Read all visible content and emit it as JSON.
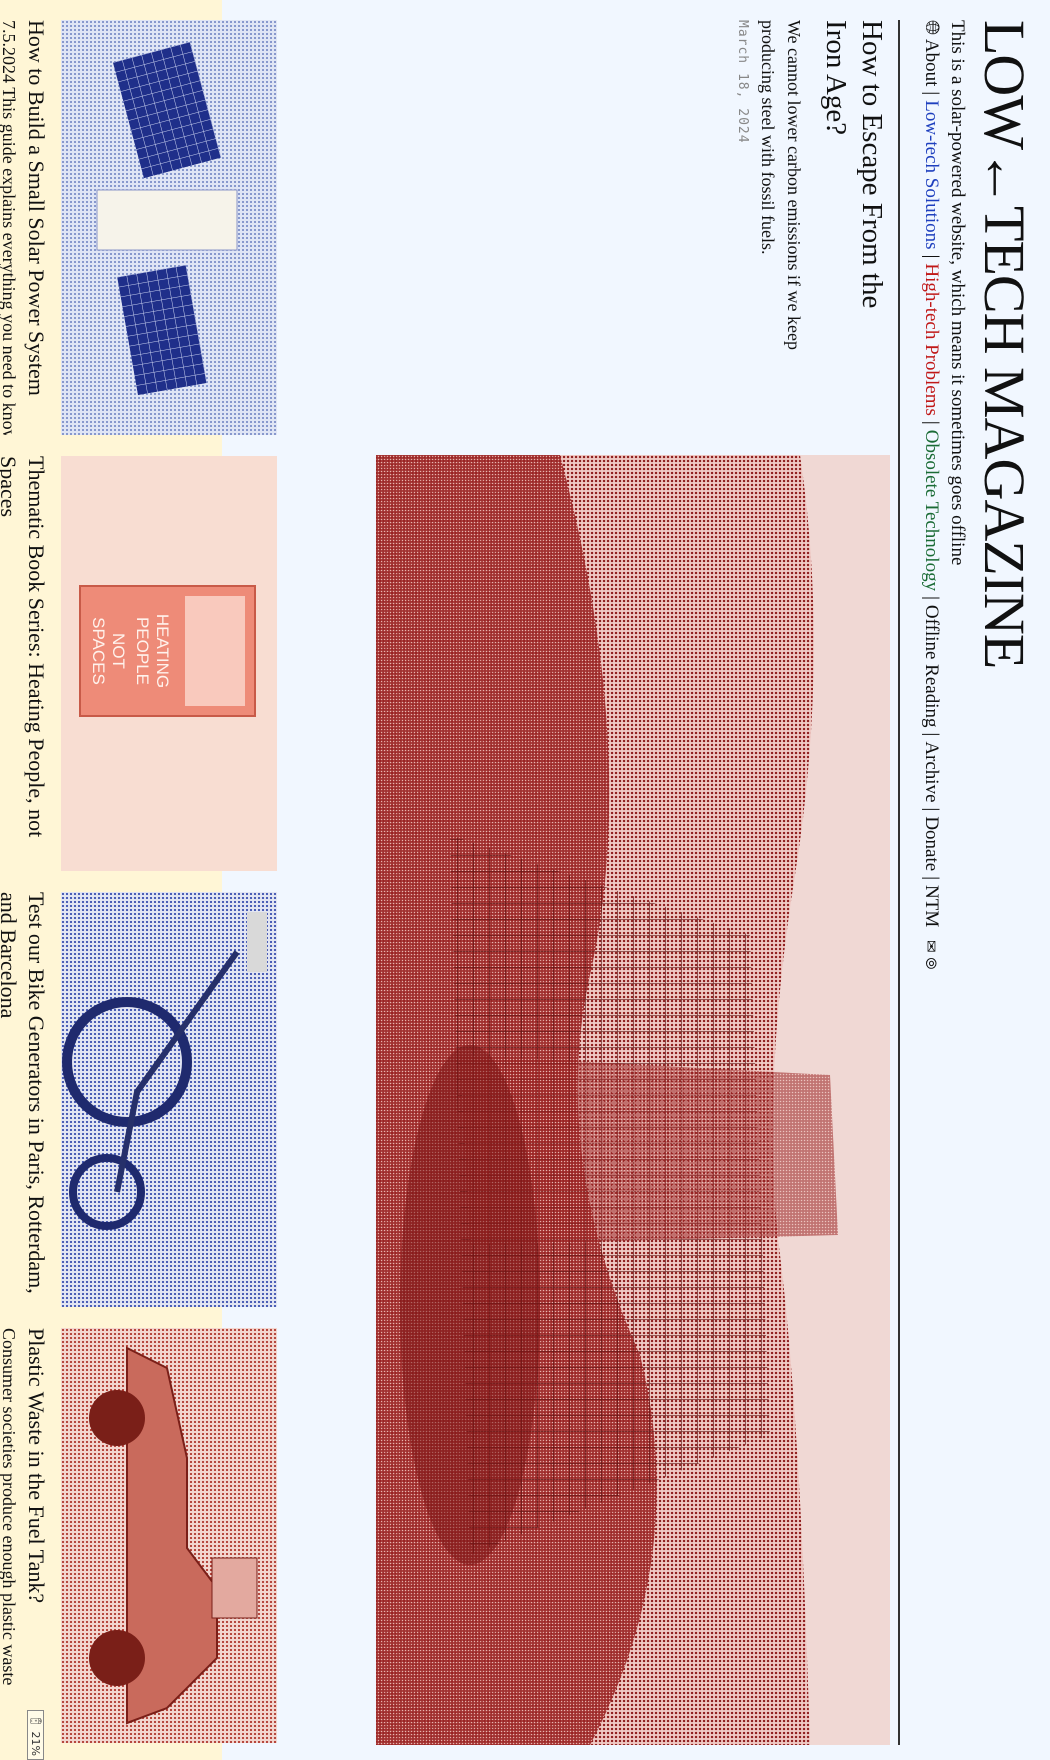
{
  "site": {
    "title": "LOW←TECH MAGAZINE",
    "tagline": "This is a solar-powered website, which means it sometimes goes offline",
    "nav": [
      {
        "label": "About",
        "color": "#111111"
      },
      {
        "label": "Low-tech Solutions",
        "color": "#1e3fbe"
      },
      {
        "label": "High-tech Problems",
        "color": "#c01818"
      },
      {
        "label": "Obsolete Technology",
        "color": "#1a6b35"
      },
      {
        "label": "Offline Reading",
        "color": "#111111"
      },
      {
        "label": "Archive",
        "color": "#111111"
      },
      {
        "label": "Donate",
        "color": "#111111"
      },
      {
        "label": "NTM",
        "color": "#111111"
      }
    ]
  },
  "feature": {
    "title": "How to Escape From the Iron Age?",
    "summary": "We cannot lower carbon emissions if we keep producing steel with fossil fuels.",
    "date": "March 18, 2024"
  },
  "cards": [
    {
      "title": "How to Build a Small Solar Power System",
      "date": "7.5.2024",
      "summary": "This guide explains everything you need to know"
    },
    {
      "title": "Thematic Book Series: Heating People, not Spaces",
      "summary": "",
      "book_cover_text": "HEATING PEOPLE NOT SPACES"
    },
    {
      "title": "Test our Bike Generators in Paris, Rotterdam, and Barcelona",
      "summary": ""
    },
    {
      "title": "Plastic Waste in the Fuel Tank?",
      "summary": "Consumer societies produce enough plastic waste"
    }
  ],
  "battery": {
    "label": "21%",
    "level_percent": 21
  },
  "colors": {
    "battery_yellow": "#fff6d6",
    "page_blue": "#f1f7ff",
    "dither_red": "#b02a2a",
    "dither_blue": "#3a4fb0"
  }
}
